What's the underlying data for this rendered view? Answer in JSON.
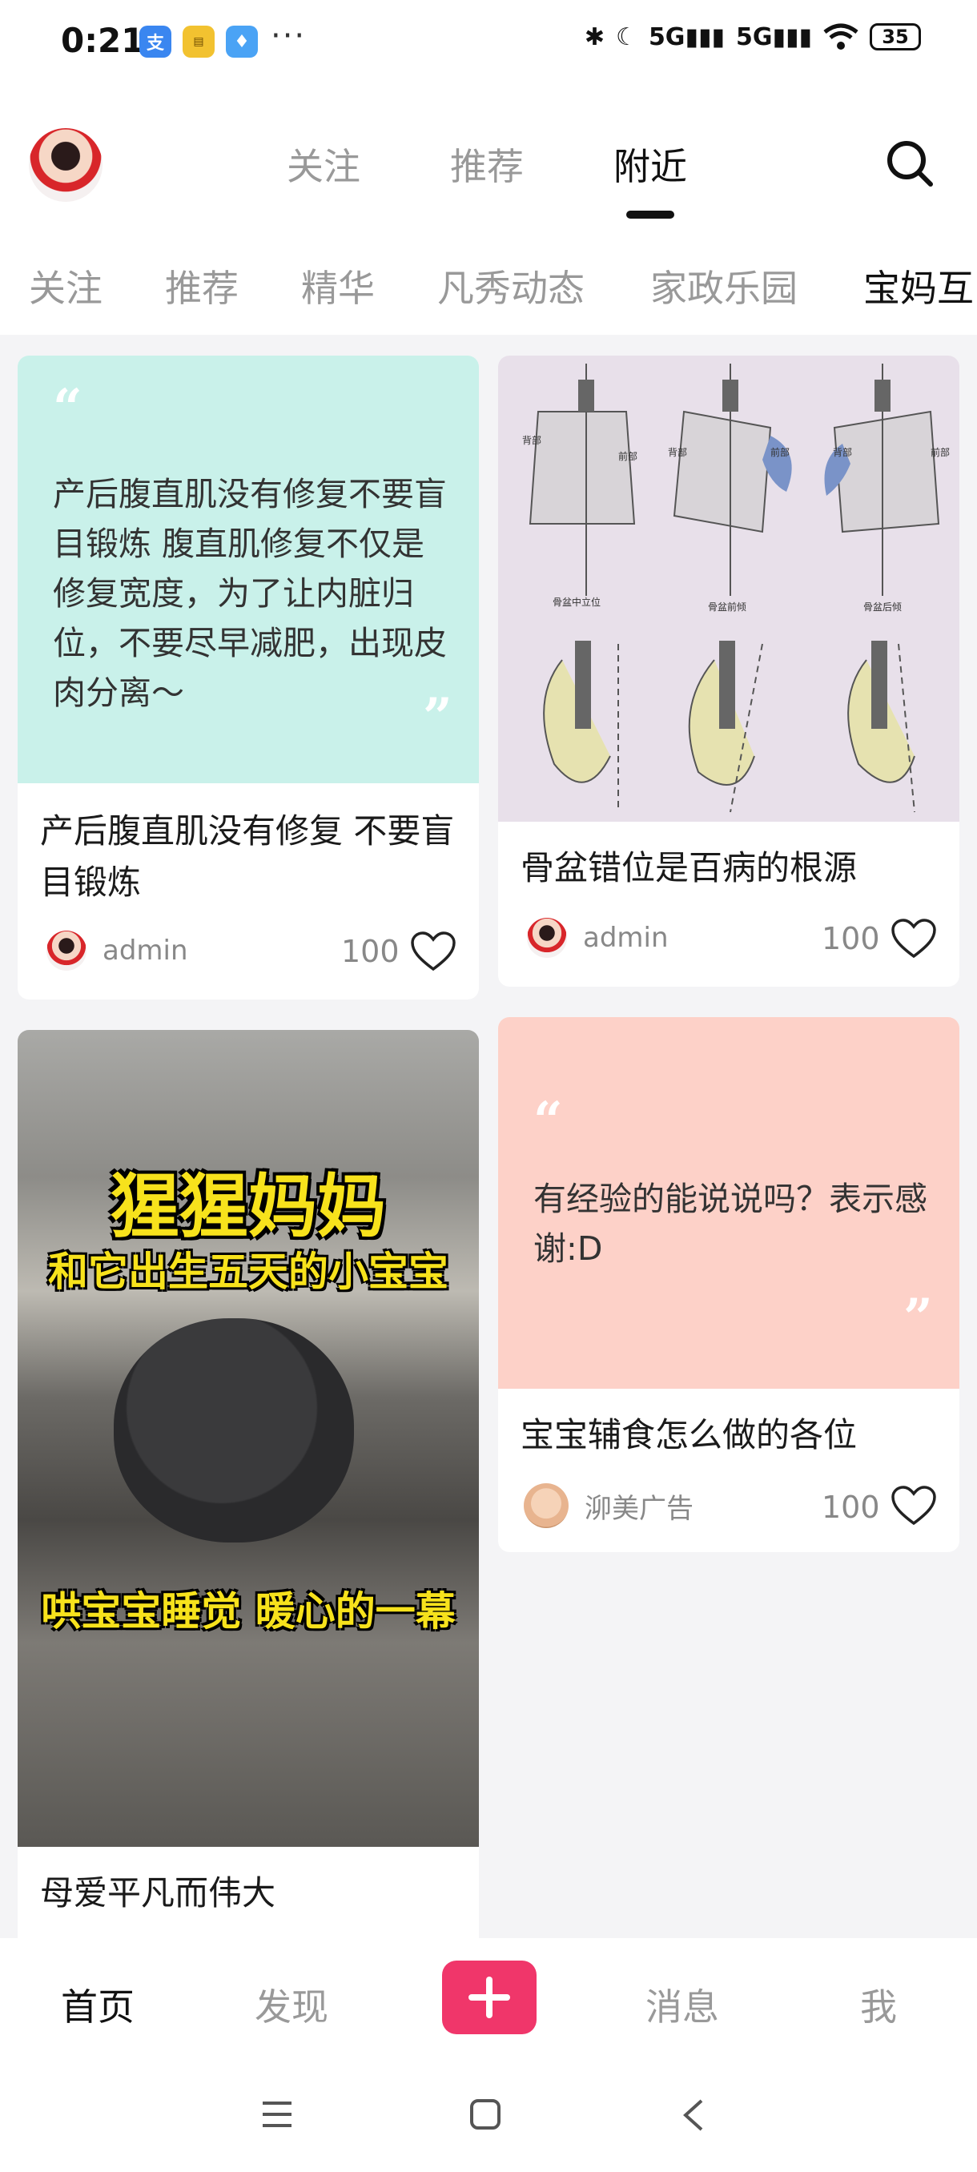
{
  "status_bar": {
    "time": "0:21",
    "network_1": "5G",
    "network_2": "5G",
    "battery": "35",
    "app_icons": [
      "alipay-icon",
      "notes-icon",
      "shirt-app-icon"
    ]
  },
  "top_tabs": [
    {
      "label": "关注",
      "active": false
    },
    {
      "label": "推荐",
      "active": false
    },
    {
      "label": "附近",
      "active": true
    }
  ],
  "categories": [
    {
      "label": "关注",
      "active": false
    },
    {
      "label": "推荐",
      "active": false
    },
    {
      "label": "精华",
      "active": false
    },
    {
      "label": "凡秀动态",
      "active": false
    },
    {
      "label": "家政乐园",
      "active": false
    },
    {
      "label": "宝妈互",
      "active": true
    }
  ],
  "cards": {
    "c1": {
      "quote": "产后腹直肌没有修复不要盲目锻炼 腹直肌修复不仅是修复宽度，为了让内脏归位，不要尽早减肥，出现皮肉分离～",
      "quote_color": "#c9f1ea",
      "title": "产后腹直肌没有修复 不要盲目锻炼",
      "author": "admin",
      "likes": "100"
    },
    "c2": {
      "image": "pelvis-diagram-image",
      "image_labels": [
        "背部",
        "前部",
        "背部",
        "前部",
        "背部",
        "前部",
        "骨盆中立位",
        "骨盆前倾",
        "骨盆后倾"
      ],
      "title": "骨盆错位是百病的根源",
      "author": "admin",
      "likes": "100"
    },
    "c3": {
      "image": "gorilla-mother-image",
      "image_caption_1": "猩猩妈妈",
      "image_caption_2": "和它出生五天的小宝宝",
      "image_caption_3": "哄宝宝睡觉 暖心的一幕",
      "title": "母爱平凡而伟大"
    },
    "c4": {
      "quote": "有经验的能说说吗？表示感谢:D",
      "quote_color": "#fdd1c8",
      "title": "宝宝辅食怎么做的各位",
      "author": "泖美广告",
      "likes": "100"
    }
  },
  "bottom_nav": {
    "home": "首页",
    "discover": "发现",
    "add": "+",
    "messages": "消息",
    "me": "我"
  },
  "colors": {
    "accent": "#f0366a",
    "background": "#f4f4f6"
  }
}
